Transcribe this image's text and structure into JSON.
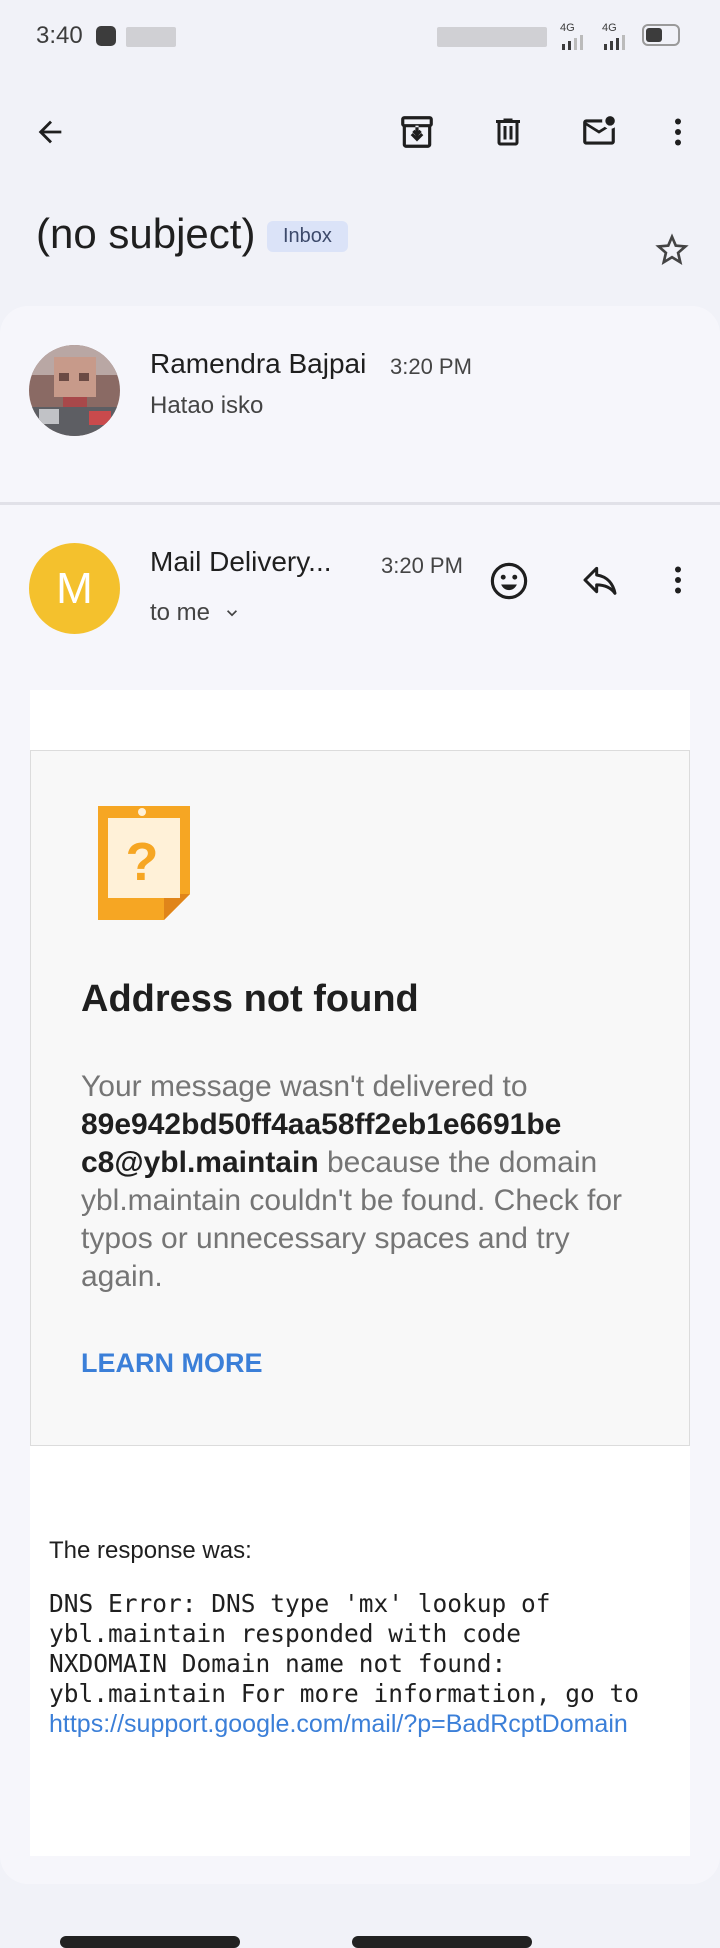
{
  "status_bar": {
    "time": "3:40",
    "signal_1": "4G",
    "signal_2": "4G"
  },
  "toolbar": {
    "back_icon": "arrow-back-icon",
    "archive_icon": "archive-icon",
    "delete_icon": "trash-icon",
    "mark_unread_icon": "mark-unread-icon",
    "more_icon": "more-vert-icon"
  },
  "thread": {
    "subject": "(no subject)",
    "label": "Inbox"
  },
  "message_1": {
    "sender": "Ramendra Bajpai",
    "time": "3:20 PM",
    "snippet": "Hatao isko"
  },
  "message_2": {
    "avatar_letter": "M",
    "sender": "Mail Delivery...",
    "time": "3:20 PM",
    "recipient": "to me"
  },
  "bounce": {
    "title": "Address not found",
    "body_prefix": "Your message wasn't delivered to ",
    "address_line1": "89e942bd50ff4aa58ff2eb1e6691be",
    "address_line2": "c8@ybl.maintain",
    "body_suffix": " because the domain ybl.maintain couldn't be found. Check for typos or unnecessary spaces and try again.",
    "learn_more": "LEARN MORE",
    "response_label": "The response was:",
    "response_text": "DNS Error: DNS type 'mx' lookup of\nybl.maintain responded with code\nNXDOMAIN Domain name not found:\nybl.maintain For more information, go to",
    "support_link": "https://support.google.com/mail/?p=BadRcptDomain"
  },
  "colors": {
    "accent_link": "#3b7fd8",
    "avatar_bg": "#f4c12d",
    "badge_bg": "#dbe3f8",
    "warning_icon": "#f6a623"
  }
}
